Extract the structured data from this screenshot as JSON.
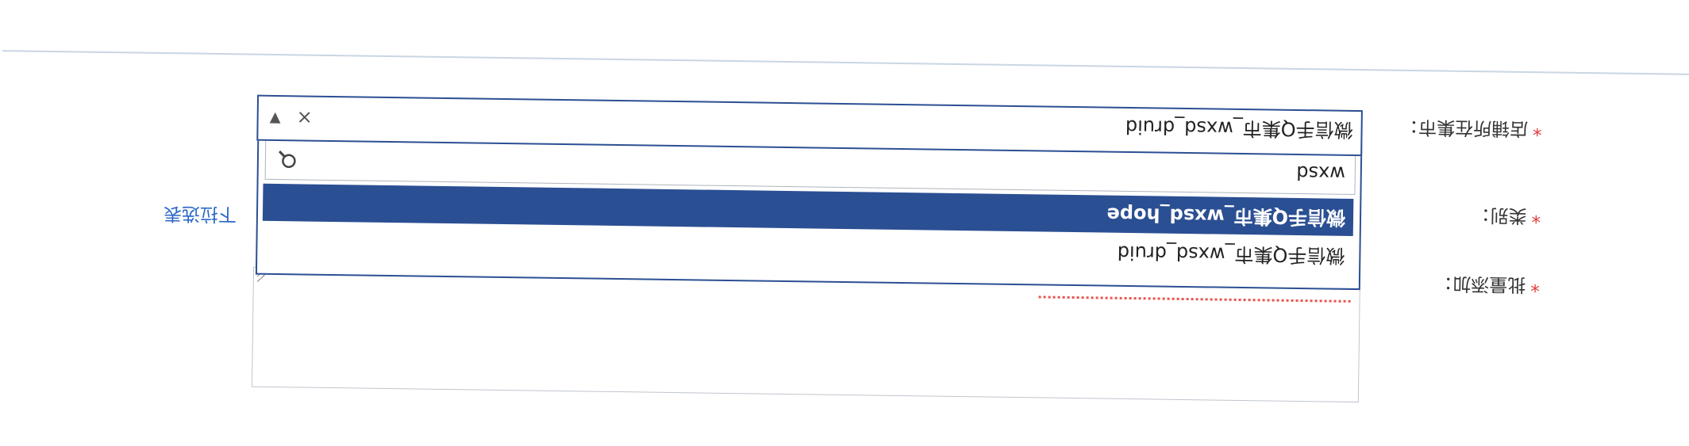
{
  "form": {
    "city_label": "店铺所在集市：",
    "category_label": "类别：",
    "batch_label": "批量添加：",
    "required_mark": "*",
    "toggle_link": "下拉选表"
  },
  "select": {
    "value": "微信手Q集市_wxsd_druid",
    "clear_glyph": "×",
    "arrow_glyph": "▼"
  },
  "dropdown": {
    "search_value": "wxsd",
    "options": [
      "微信手Q集市_wxsd_hope",
      "微信手Q集市_wxsd_druid"
    ]
  },
  "colors": {
    "accent": "#2b4f93",
    "required": "#e4393c",
    "link": "#2a66c5"
  }
}
